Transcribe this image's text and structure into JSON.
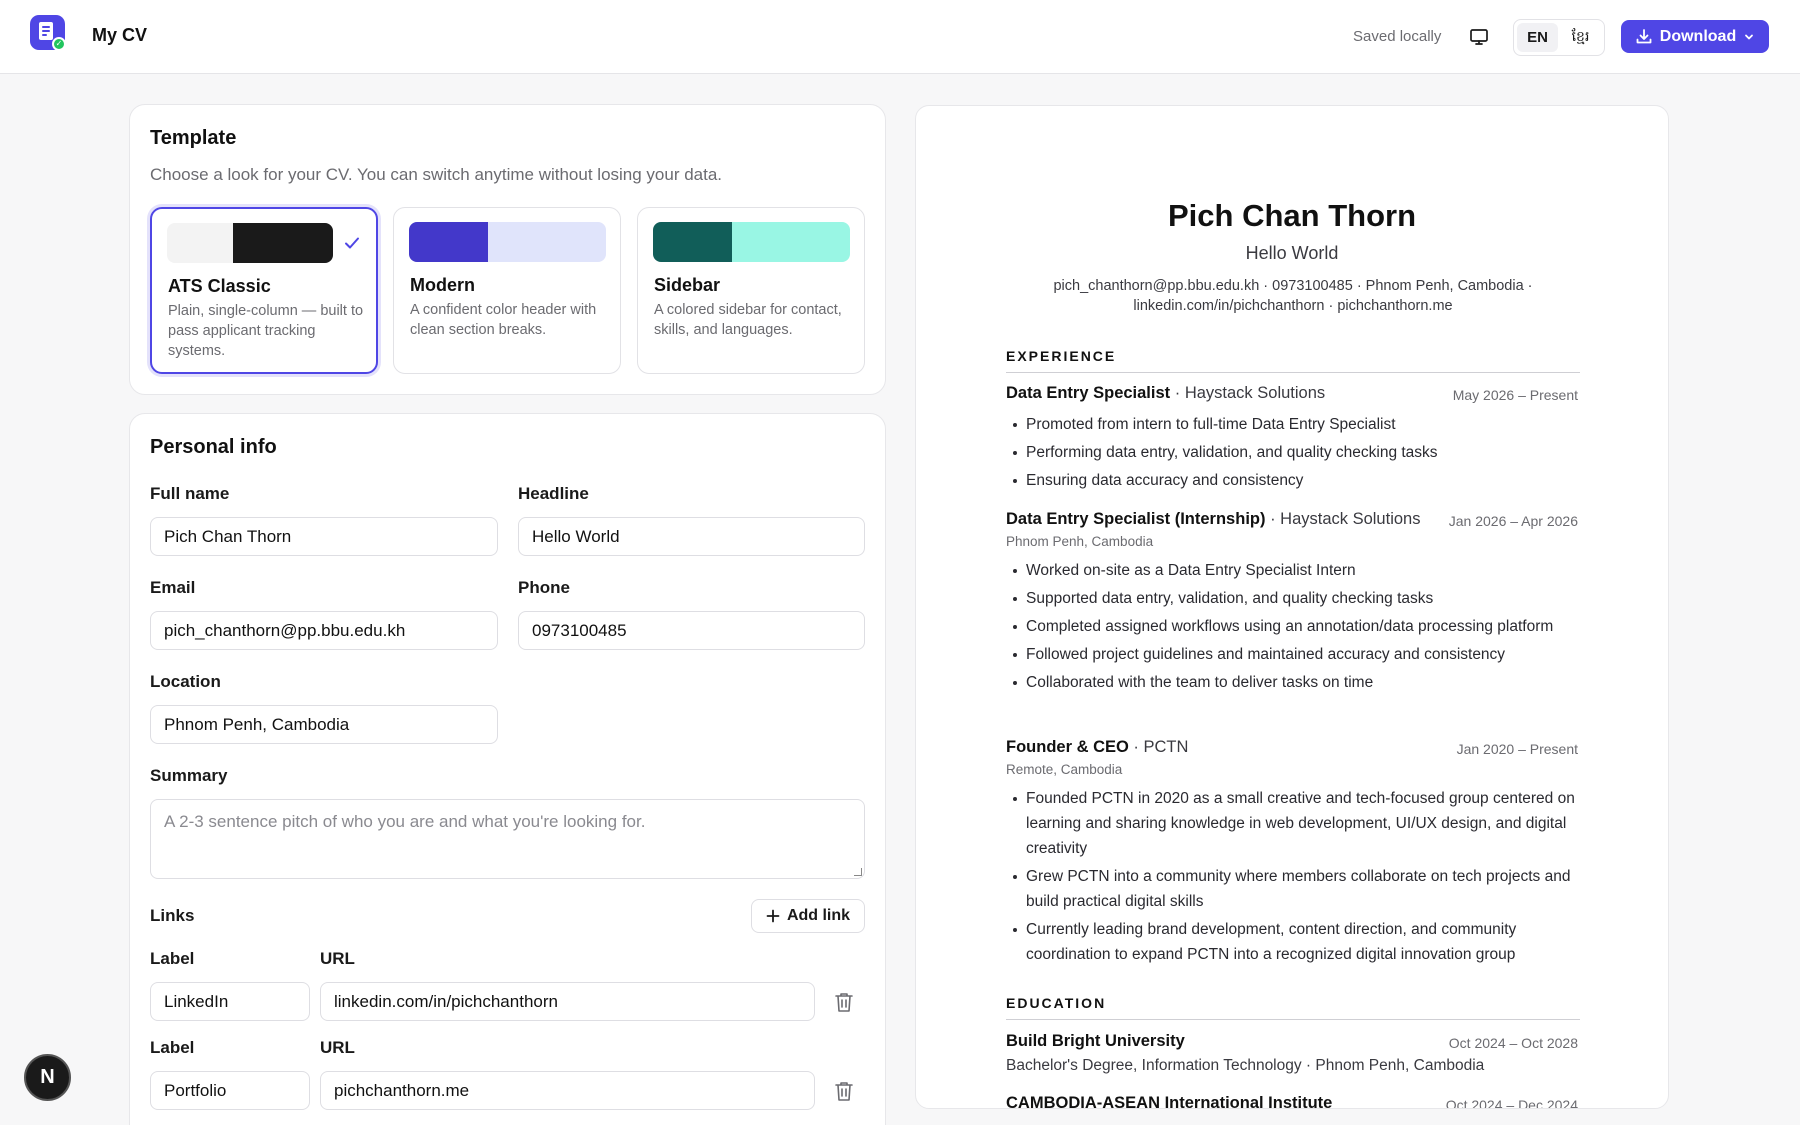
{
  "header": {
    "app_title": "My CV",
    "saved_status": "Saved locally",
    "lang_en": "EN",
    "lang_km": "ខ្មែរ",
    "download_label": "Download",
    "accent": "#4f46e5"
  },
  "template_card": {
    "title": "Template",
    "subtitle": "Choose a look for your CV. You can switch anytime without losing your data.",
    "options": [
      {
        "name": "ATS Classic",
        "desc": "Plain, single-column — built to pass applicant tracking systems.",
        "selected": true,
        "swatch": [
          "#f3f3f3",
          "#1a1a1a"
        ]
      },
      {
        "name": "Modern",
        "desc": "A confident color header with clean section breaks.",
        "selected": false,
        "swatch": [
          "#4338ca",
          "#e0e4fb"
        ]
      },
      {
        "name": "Sidebar",
        "desc": "A colored sidebar for contact, skills, and languages.",
        "selected": false,
        "swatch": [
          "#115e59",
          "#99f6e4"
        ]
      }
    ]
  },
  "personal": {
    "title": "Personal info",
    "full_name_label": "Full name",
    "full_name": "Pich Chan Thorn",
    "headline_label": "Headline",
    "headline": "Hello World",
    "email_label": "Email",
    "email": "pich_chanthorn@pp.bbu.edu.kh",
    "phone_label": "Phone",
    "phone": "0973100485",
    "location_label": "Location",
    "location": "Phnom Penh, Cambodia",
    "summary_label": "Summary",
    "summary_placeholder": "A 2-3 sentence pitch of who you are and what you're looking for.",
    "links_label": "Links",
    "add_link_label": "Add link",
    "links": [
      {
        "label_caption": "Label",
        "url_caption": "URL",
        "label": "LinkedIn",
        "url": "linkedin.com/in/pichchanthorn"
      },
      {
        "label_caption": "Label",
        "url_caption": "URL",
        "label": "Portfolio",
        "url": "pichchanthorn.me"
      }
    ]
  },
  "badge": "N",
  "preview": {
    "name": "Pich Chan Thorn",
    "headline": "Hello World",
    "contact_line1": "pich_chanthorn@pp.bbu.edu.kh · 0973100485 · Phnom Penh, Cambodia ·",
    "contact_line2": "linkedin.com/in/pichchanthorn · pichchanthorn.me",
    "experience_heading": "EXPERIENCE",
    "jobs": [
      {
        "title": "Data Entry Specialist",
        "org": " · Haystack Solutions",
        "date": "May 2026 – Present",
        "location": "",
        "bullets": [
          "Promoted from intern to full-time Data Entry Specialist",
          "Performing data entry, validation, and quality checking tasks",
          "Ensuring data accuracy and consistency"
        ]
      },
      {
        "title": "Data Entry Specialist (Internship)",
        "org": " · Haystack Solutions",
        "date": "Jan 2026 – Apr 2026",
        "location": "Phnom Penh, Cambodia",
        "bullets": [
          "Worked on-site as a Data Entry Specialist Intern",
          "Supported data entry, validation, and quality checking tasks",
          "Completed assigned workflows using an annotation/data processing platform",
          "Followed project guidelines and maintained accuracy and consistency",
          "Collaborated with the team to deliver tasks on time"
        ]
      },
      {
        "title": "Founder & CEO",
        "org": " · PCTN",
        "date": "Jan 2020 – Present",
        "location": "Remote, Cambodia",
        "bullets": [
          "Founded PCTN in 2020 as a small creative and tech-focused group centered on learning and sharing knowledge in web development, UI/UX design, and digital creativity",
          "Grew PCTN into a community where members collaborate on tech projects and build practical digital skills",
          "Currently leading brand development, content direction, and community coordination to expand PCTN into a recognized digital innovation group"
        ]
      }
    ],
    "education_heading": "EDUCATION",
    "education": [
      {
        "school": "Build Bright University",
        "date": "Oct 2024 – Oct 2028",
        "detail": "Bachelor's Degree, Information Technology · Phnom Penh, Cambodia"
      },
      {
        "school": "CAMBODIA-ASEAN International Institute",
        "date": "Oct 2024 – Dec 2024",
        "detail": ""
      }
    ]
  }
}
